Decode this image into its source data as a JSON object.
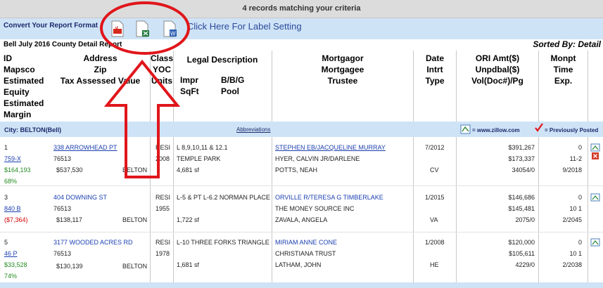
{
  "status": "4 records matching your criteria",
  "convert": {
    "label": "Convert Your Report Format",
    "formats": [
      "PDF",
      "Excel",
      "Word"
    ],
    "label_setting": "Click Here For Label Setting"
  },
  "report": {
    "title": "Bell   July 2016 County Detail Report",
    "sorted_by": "Sorted By: Detail"
  },
  "columns": {
    "col1": [
      "ID",
      "Mapsco",
      "Estimated",
      "Equity",
      "Estimated",
      "Margin"
    ],
    "col2": [
      "Address",
      "Zip",
      "Tax Assessed Value"
    ],
    "col3": [
      "Class",
      "YOC",
      "Units"
    ],
    "col4_title": "Legal Description",
    "col4_sub": [
      "Impr",
      "SqFt"
    ],
    "col4_sub2": [
      "B/B/G",
      "Pool"
    ],
    "col5": [
      "Mortgagor",
      "Mortgagee",
      "Trustee"
    ],
    "col6": [
      "Date",
      "Intrt",
      "Type"
    ],
    "col7": [
      "ORI Amt($)",
      "Unpdbal($)",
      "Vol(Doc#)/Pg"
    ],
    "col8": [
      "Monpt",
      "Time",
      "Exp."
    ]
  },
  "city_bar": {
    "city": "City: BELTON(Bell)",
    "abbreviations": "Abbreviations",
    "zillow": "= www.zillow.com",
    "posted": "= Previously Posted"
  },
  "rows": [
    {
      "id": "1",
      "mapsco": "759-X",
      "equity": "$164,193",
      "margin": "68%",
      "address": "338 ARROWHEAD PT",
      "zip": "76513",
      "tav": "$537,530",
      "city": "BELTON",
      "class": "RESI",
      "yoc": "2008",
      "legal": "L 8,9,10,11 & 12.1",
      "legal2": "TEMPLE PARK",
      "sqft": "4,681 sf",
      "mortgagor": "STEPHEN EB/JACQUELINE MURRAY",
      "mortgagee": "HYER, CALVIN JR/DARLENE",
      "trustee": "POTTS, NEAH",
      "date": "7/2012",
      "type": "CV",
      "ori": "$391,267",
      "unpd": "$173,337",
      "vol": "34054/0",
      "monpt": "0",
      "time": "11-2",
      "exp": "9/2018"
    },
    {
      "id": "3",
      "mapsco": "840 B",
      "equity": "($7,364)",
      "margin": "",
      "address": "404 DOWNING ST",
      "zip": "76513",
      "tav": "$138,117",
      "city": "BELTON",
      "class": "RESI",
      "yoc": "1955",
      "legal": "L-5 & PT L-6.2 NORMAN PLACE",
      "legal2": "",
      "sqft": "1,722 sf",
      "mortgagor": "ORVILLE R/TERESA G TIMBERLAKE",
      "mortgagee": "THE MONEY SOURCE INC",
      "trustee": "ZAVALA, ANGELA",
      "date": "1/2015",
      "type": "VA",
      "ori": "$146,686",
      "unpd": "$145,481",
      "vol": "2075/0",
      "monpt": "0",
      "time": "10 1",
      "exp": "2/2045"
    },
    {
      "id": "5",
      "mapsco": "46 P",
      "equity": "$33,528",
      "margin": "74%",
      "address": "3177 WOODED ACRES RD",
      "zip": "76513",
      "tav": "$130,139",
      "city": "BELTON",
      "class": "RESI",
      "yoc": "1978",
      "legal": "L-10 THREE FORKS TRIANGLE",
      "legal2": "",
      "sqft": "1,681 sf",
      "mortgagor": "MIRIAM ANNE CONE",
      "mortgagee": "CHRISTIANA TRUST",
      "trustee": "LATHAM, JOHN",
      "date": "1/2008",
      "type": "HE",
      "ori": "$120,000",
      "unpd": "$105,611",
      "vol": "4229/0",
      "monpt": "0",
      "time": "10 1",
      "exp": "2/2038"
    }
  ],
  "colors": {
    "annotation_red": "#e0161b",
    "bar_blue": "#cfe3f7"
  }
}
